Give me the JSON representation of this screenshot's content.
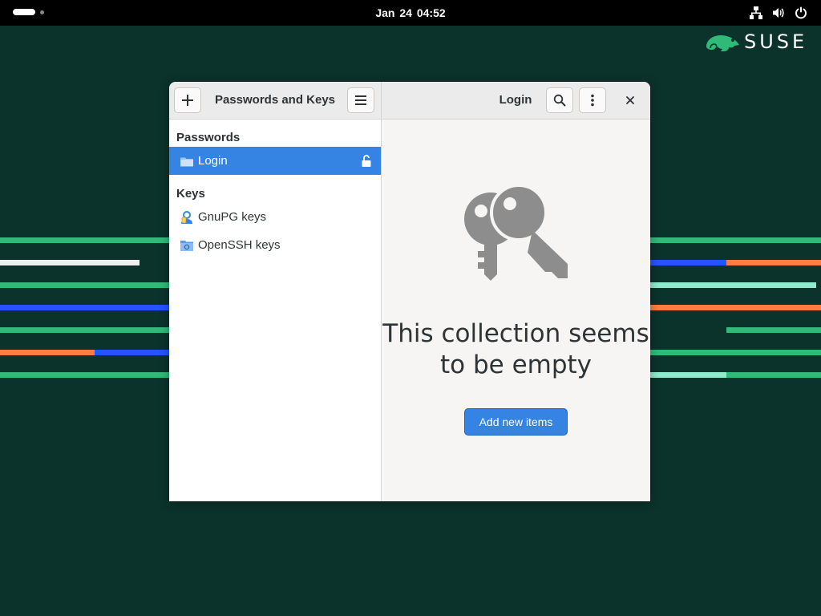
{
  "topbar": {
    "date": "Jan 24",
    "time": "04:52",
    "icons": [
      "network-wired-icon",
      "volume-icon",
      "power-icon"
    ]
  },
  "branding": {
    "logo_text": "SUSE"
  },
  "window": {
    "sidebar_title": "Passwords and Keys",
    "content_title": "Login",
    "sidebar": {
      "sections": [
        {
          "title": "Passwords",
          "items": [
            {
              "label": "Login",
              "icon": "folder-icon",
              "locked": true,
              "selected": true
            }
          ]
        },
        {
          "title": "Keys",
          "items": [
            {
              "label": "GnuPG keys",
              "icon": "gnupg-icon"
            },
            {
              "label": "OpenSSH keys",
              "icon": "ssh-folder-icon"
            }
          ]
        }
      ]
    },
    "empty_state": {
      "line1": "This collection seems",
      "line2": "to be empty",
      "button": "Add new items"
    }
  },
  "colors": {
    "accent": "#3584e4",
    "desktop_bg": "#0c322c",
    "stripe_green": "#30ba78",
    "stripe_blue": "#2453ff",
    "stripe_orange": "#fe7c3f",
    "stripe_mint": "#90ebcd"
  }
}
